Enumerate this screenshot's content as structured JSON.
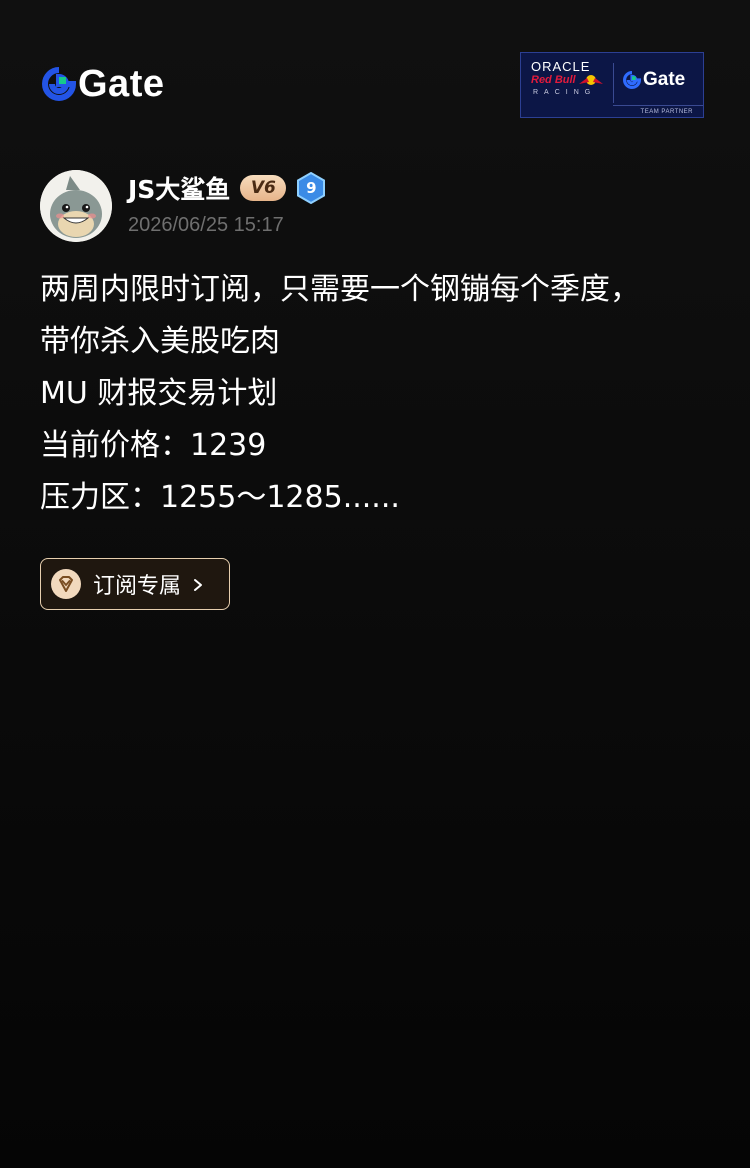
{
  "brand": {
    "logo_text": "Gate",
    "accent": "#2354e6"
  },
  "partner_badge": {
    "oracle": "ORACLE",
    "redbull": "Red Bull",
    "racing": "RACING",
    "gate": "Gate",
    "team_partner": "TEAM PARTNER"
  },
  "post": {
    "author": "JS大鲨鱼",
    "vip_label": "V6",
    "level": "9",
    "timestamp": "2026/06/25 15:17",
    "lines": [
      "两周内限时订阅，只需要一个钢镚每个季度，",
      "带你杀入美股吃肉",
      "MU 财报交易计划",
      "当前价格：1239",
      "压力区：1255～1285......"
    ],
    "subscribe_label": "订阅专属"
  },
  "icons": {
    "avatar": "shark-avatar",
    "subscribe": "diamond-heart-icon",
    "chevron": "chevron-right-icon"
  }
}
